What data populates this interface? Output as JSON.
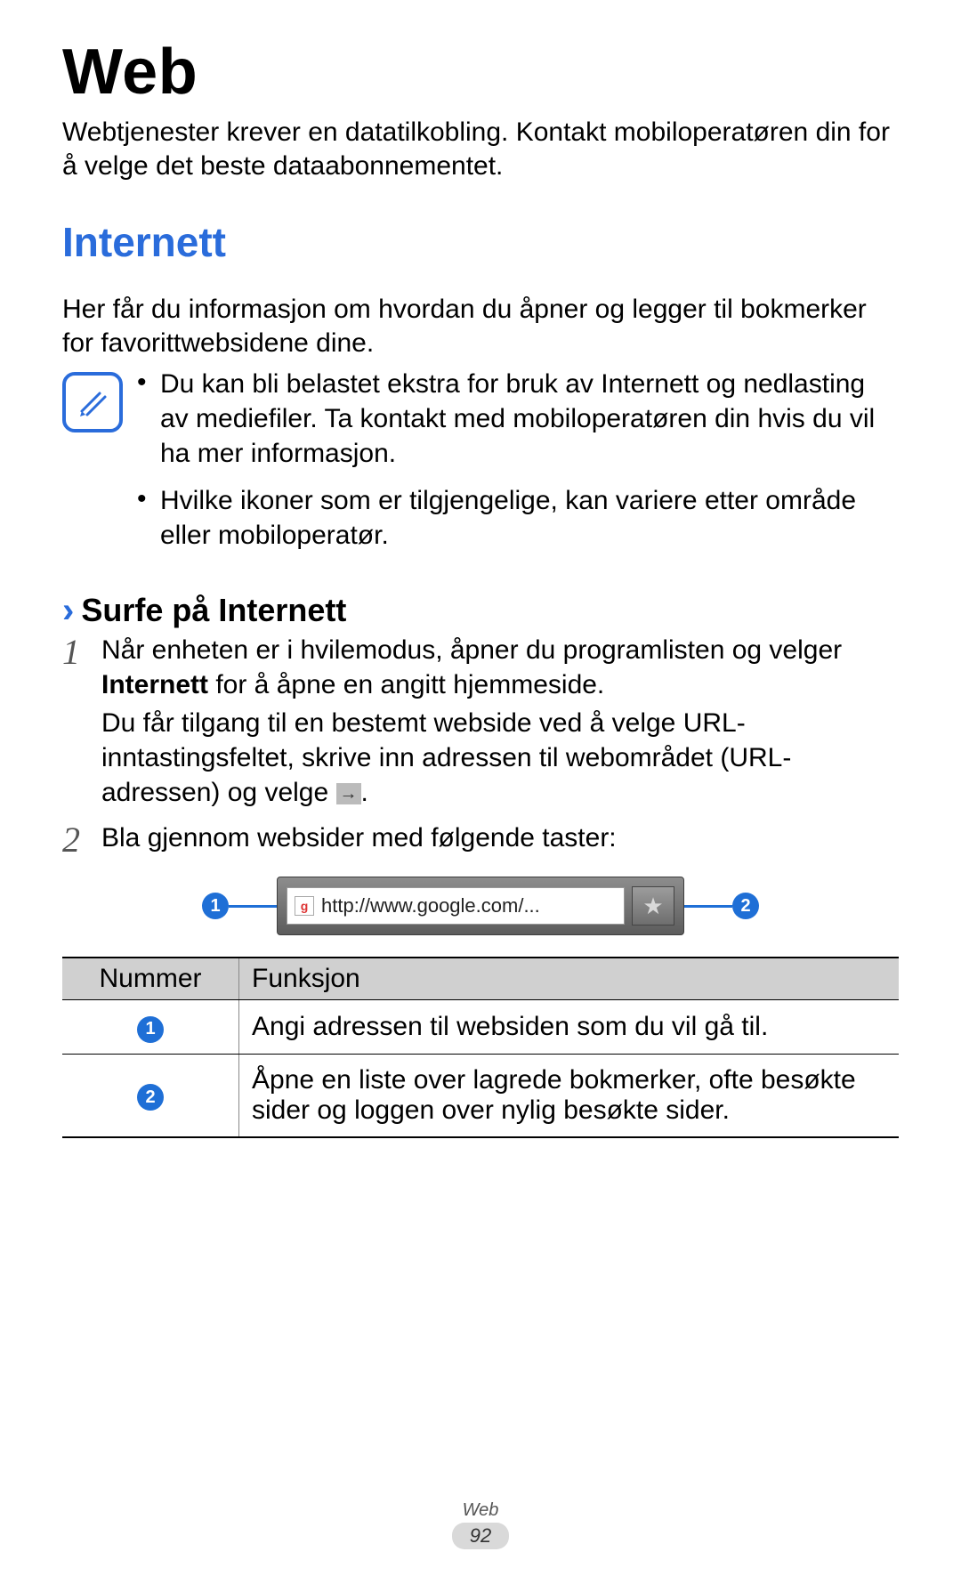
{
  "page": {
    "title": "Web",
    "intro": "Webtjenester krever en datatilkobling. Kontakt mobiloperatøren din for å velge det beste dataabonnementet."
  },
  "section": {
    "heading": "Internett",
    "intro": "Her får du informasjon om hvordan du åpner og legger til bokmerker for favorittwebsidene dine.",
    "notes": [
      "Du kan bli belastet ekstra for bruk av Internett og nedlasting av mediefiler. Ta kontakt med mobiloperatøren din hvis du vil ha mer informasjon.",
      "Hvilke ikoner som er tilgjengelige, kan variere etter område eller mobiloperatør."
    ]
  },
  "subsection": {
    "heading": "Surfe på Internett",
    "step1_a": "Når enheten er i hvilemodus, åpner du programlisten og velger ",
    "step1_bold": "Internett",
    "step1_b": " for å åpne en angitt hjemmeside.",
    "step1_para2_a": "Du får tilgang til en bestemt webside ved å velge URL-inntastingsfeltet, skrive inn adressen til webområdet (URL-adressen) og velge ",
    "step1_para2_b": ".",
    "step2": "Bla gjennom websider med følgende taster:"
  },
  "urlbar": {
    "callout1": "1",
    "callout2": "2",
    "favicon": "g",
    "url": "http://www.google.com/...",
    "bookmark_glyph": "★"
  },
  "table": {
    "head_num": "Nummer",
    "head_func": "Funksjon",
    "rows": [
      {
        "n": "1",
        "text": "Angi adressen til websiden som du vil gå til."
      },
      {
        "n": "2",
        "text": "Åpne en liste over lagrede bokmerker, ofte besøkte sider og loggen over nylig besøkte sider."
      }
    ]
  },
  "footer": {
    "category": "Web",
    "page_number": "92"
  }
}
